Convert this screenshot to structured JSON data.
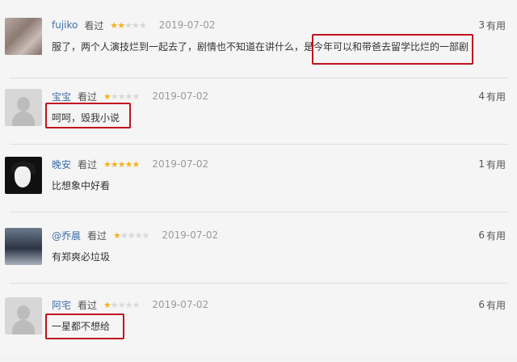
{
  "reviews": [
    {
      "username": "fujiko",
      "status": "看过",
      "stars_on": 2,
      "stars_total": 5,
      "date": "2019-07-02",
      "helpful_count": "3",
      "helpful_label": "有用",
      "text": "服了，两个人演技烂到一起去了，剧情也不知道在讲什么，是今年可以和带爸去留学比烂的一部剧"
    },
    {
      "username": "宝宝",
      "status": "看过",
      "stars_on": 1,
      "stars_total": 5,
      "date": "2019-07-02",
      "helpful_count": "4",
      "helpful_label": "有用",
      "text": "呵呵，毁我小说"
    },
    {
      "username": "晚安",
      "status": "看过",
      "stars_on": 5,
      "stars_total": 5,
      "date": "2019-07-02",
      "helpful_count": "1",
      "helpful_label": "有用",
      "text": "比想象中好看"
    },
    {
      "username": "@乔晨",
      "status": "看过",
      "stars_on": 1,
      "stars_total": 5,
      "date": "2019-07-02",
      "helpful_count": "6",
      "helpful_label": "有用",
      "text": "有郑爽必垃圾"
    },
    {
      "username": "阿宅",
      "status": "看过",
      "stars_on": 1,
      "stars_total": 5,
      "date": "2019-07-02",
      "helpful_count": "6",
      "helpful_label": "有用",
      "text": "一星都不想给"
    }
  ],
  "colors": {
    "background": "#f5f5f5",
    "username_link": "#3f6fa7",
    "star_on": "#f2b31e",
    "highlight_border": "#c1121f"
  }
}
